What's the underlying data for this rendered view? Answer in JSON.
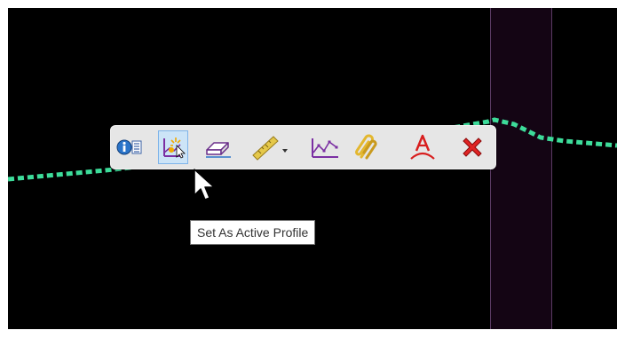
{
  "canvas": {
    "background": "#000000",
    "profile_color": "#3ddc9a",
    "band_color": "#140514"
  },
  "toolbar": {
    "buttons": [
      {
        "name": "properties-button",
        "icon": "info-list-icon"
      },
      {
        "name": "set-active-profile-button",
        "icon": "active-profile-icon",
        "state": "selected"
      },
      {
        "name": "eraser-button",
        "icon": "eraser-icon"
      },
      {
        "name": "measure-button",
        "icon": "ruler-icon",
        "has_dropdown": true
      },
      {
        "name": "profile-points-button",
        "icon": "profile-graph-icon"
      },
      {
        "name": "copy-link-button",
        "icon": "paperclip-icon"
      },
      {
        "name": "text-label-button",
        "icon": "text-arc-icon"
      },
      {
        "name": "delete-button",
        "icon": "red-x-icon"
      }
    ]
  },
  "tooltip": {
    "text": "Set As Active Profile"
  },
  "cursor": {
    "icon": "arrow-cursor-icon"
  }
}
